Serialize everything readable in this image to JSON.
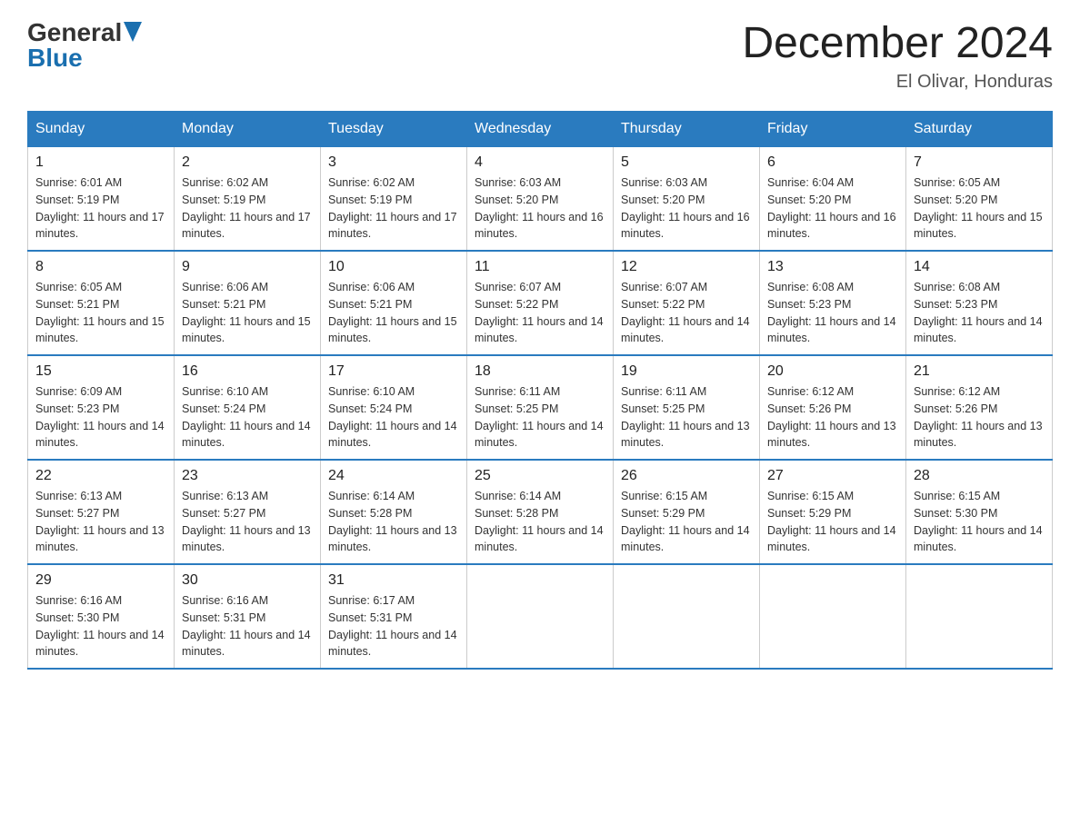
{
  "header": {
    "logo_general": "General",
    "logo_blue": "Blue",
    "month_title": "December 2024",
    "location": "El Olivar, Honduras"
  },
  "days_of_week": [
    "Sunday",
    "Monday",
    "Tuesday",
    "Wednesday",
    "Thursday",
    "Friday",
    "Saturday"
  ],
  "weeks": [
    [
      {
        "day": "1",
        "sunrise": "6:01 AM",
        "sunset": "5:19 PM",
        "daylight": "11 hours and 17 minutes."
      },
      {
        "day": "2",
        "sunrise": "6:02 AM",
        "sunset": "5:19 PM",
        "daylight": "11 hours and 17 minutes."
      },
      {
        "day": "3",
        "sunrise": "6:02 AM",
        "sunset": "5:19 PM",
        "daylight": "11 hours and 17 minutes."
      },
      {
        "day": "4",
        "sunrise": "6:03 AM",
        "sunset": "5:20 PM",
        "daylight": "11 hours and 16 minutes."
      },
      {
        "day": "5",
        "sunrise": "6:03 AM",
        "sunset": "5:20 PM",
        "daylight": "11 hours and 16 minutes."
      },
      {
        "day": "6",
        "sunrise": "6:04 AM",
        "sunset": "5:20 PM",
        "daylight": "11 hours and 16 minutes."
      },
      {
        "day": "7",
        "sunrise": "6:05 AM",
        "sunset": "5:20 PM",
        "daylight": "11 hours and 15 minutes."
      }
    ],
    [
      {
        "day": "8",
        "sunrise": "6:05 AM",
        "sunset": "5:21 PM",
        "daylight": "11 hours and 15 minutes."
      },
      {
        "day": "9",
        "sunrise": "6:06 AM",
        "sunset": "5:21 PM",
        "daylight": "11 hours and 15 minutes."
      },
      {
        "day": "10",
        "sunrise": "6:06 AM",
        "sunset": "5:21 PM",
        "daylight": "11 hours and 15 minutes."
      },
      {
        "day": "11",
        "sunrise": "6:07 AM",
        "sunset": "5:22 PM",
        "daylight": "11 hours and 14 minutes."
      },
      {
        "day": "12",
        "sunrise": "6:07 AM",
        "sunset": "5:22 PM",
        "daylight": "11 hours and 14 minutes."
      },
      {
        "day": "13",
        "sunrise": "6:08 AM",
        "sunset": "5:23 PM",
        "daylight": "11 hours and 14 minutes."
      },
      {
        "day": "14",
        "sunrise": "6:08 AM",
        "sunset": "5:23 PM",
        "daylight": "11 hours and 14 minutes."
      }
    ],
    [
      {
        "day": "15",
        "sunrise": "6:09 AM",
        "sunset": "5:23 PM",
        "daylight": "11 hours and 14 minutes."
      },
      {
        "day": "16",
        "sunrise": "6:10 AM",
        "sunset": "5:24 PM",
        "daylight": "11 hours and 14 minutes."
      },
      {
        "day": "17",
        "sunrise": "6:10 AM",
        "sunset": "5:24 PM",
        "daylight": "11 hours and 14 minutes."
      },
      {
        "day": "18",
        "sunrise": "6:11 AM",
        "sunset": "5:25 PM",
        "daylight": "11 hours and 14 minutes."
      },
      {
        "day": "19",
        "sunrise": "6:11 AM",
        "sunset": "5:25 PM",
        "daylight": "11 hours and 13 minutes."
      },
      {
        "day": "20",
        "sunrise": "6:12 AM",
        "sunset": "5:26 PM",
        "daylight": "11 hours and 13 minutes."
      },
      {
        "day": "21",
        "sunrise": "6:12 AM",
        "sunset": "5:26 PM",
        "daylight": "11 hours and 13 minutes."
      }
    ],
    [
      {
        "day": "22",
        "sunrise": "6:13 AM",
        "sunset": "5:27 PM",
        "daylight": "11 hours and 13 minutes."
      },
      {
        "day": "23",
        "sunrise": "6:13 AM",
        "sunset": "5:27 PM",
        "daylight": "11 hours and 13 minutes."
      },
      {
        "day": "24",
        "sunrise": "6:14 AM",
        "sunset": "5:28 PM",
        "daylight": "11 hours and 13 minutes."
      },
      {
        "day": "25",
        "sunrise": "6:14 AM",
        "sunset": "5:28 PM",
        "daylight": "11 hours and 14 minutes."
      },
      {
        "day": "26",
        "sunrise": "6:15 AM",
        "sunset": "5:29 PM",
        "daylight": "11 hours and 14 minutes."
      },
      {
        "day": "27",
        "sunrise": "6:15 AM",
        "sunset": "5:29 PM",
        "daylight": "11 hours and 14 minutes."
      },
      {
        "day": "28",
        "sunrise": "6:15 AM",
        "sunset": "5:30 PM",
        "daylight": "11 hours and 14 minutes."
      }
    ],
    [
      {
        "day": "29",
        "sunrise": "6:16 AM",
        "sunset": "5:30 PM",
        "daylight": "11 hours and 14 minutes."
      },
      {
        "day": "30",
        "sunrise": "6:16 AM",
        "sunset": "5:31 PM",
        "daylight": "11 hours and 14 minutes."
      },
      {
        "day": "31",
        "sunrise": "6:17 AM",
        "sunset": "5:31 PM",
        "daylight": "11 hours and 14 minutes."
      },
      null,
      null,
      null,
      null
    ]
  ]
}
